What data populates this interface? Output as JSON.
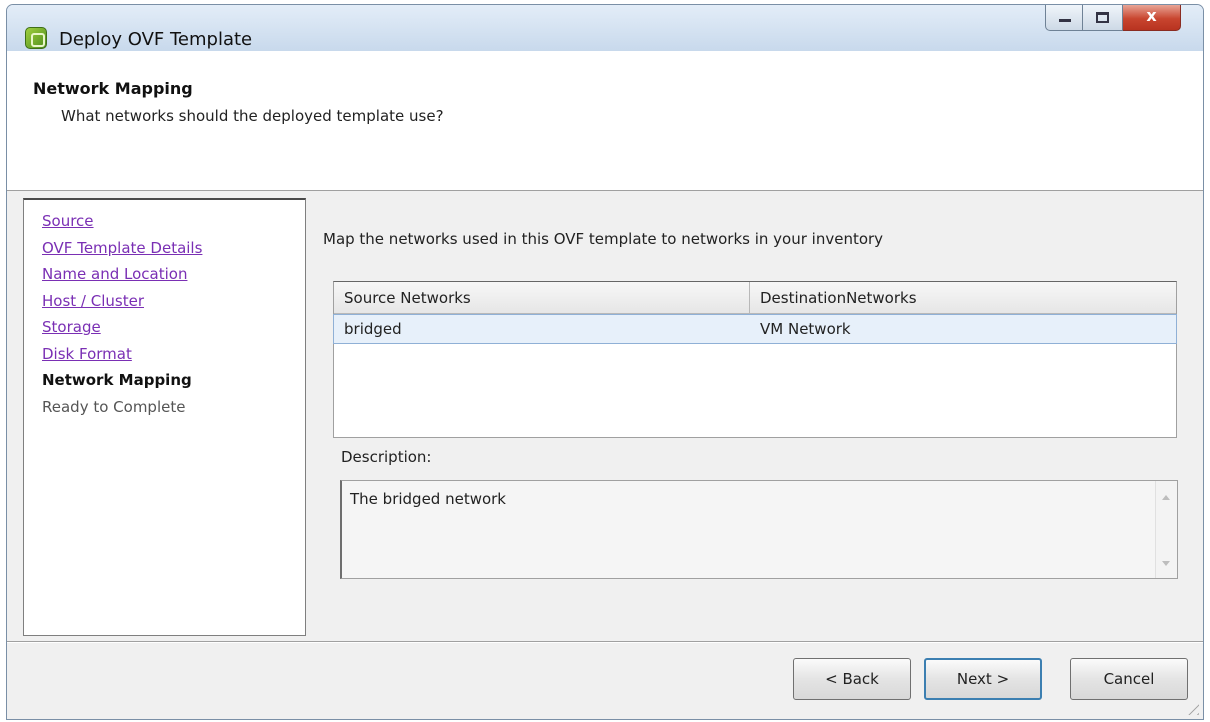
{
  "window": {
    "title": "Deploy OVF Template",
    "controls": {
      "minimize": "",
      "maximize": "",
      "close": "x"
    }
  },
  "header": {
    "title": "Network Mapping",
    "subtitle": "What networks should the deployed template use?"
  },
  "nav": {
    "items": [
      {
        "label": "Source",
        "state": "link"
      },
      {
        "label": "OVF Template Details",
        "state": "link"
      },
      {
        "label": "Name and Location",
        "state": "link"
      },
      {
        "label": "Host / Cluster",
        "state": "link"
      },
      {
        "label": "Storage",
        "state": "link"
      },
      {
        "label": "Disk Format",
        "state": "link"
      },
      {
        "label": "Network Mapping",
        "state": "current"
      },
      {
        "label": "Ready to Complete",
        "state": "future"
      }
    ]
  },
  "main": {
    "instruction": "Map the networks used in this OVF template to networks in your inventory",
    "table": {
      "columns": [
        "Source Networks",
        "DestinationNetworks"
      ],
      "rows": [
        {
          "source": "bridged",
          "destination": "VM Network",
          "selected": true
        }
      ]
    },
    "description": {
      "label": "Description:",
      "text": "The bridged network"
    }
  },
  "footer": {
    "back_label": "< Back",
    "next_label": "Next >",
    "cancel_label": "Cancel"
  },
  "colors": {
    "link": "#7a2fb4",
    "selected_row": "#e7f0fa",
    "default_button_border": "#3c7fb1",
    "close_button": "#c8452f"
  }
}
